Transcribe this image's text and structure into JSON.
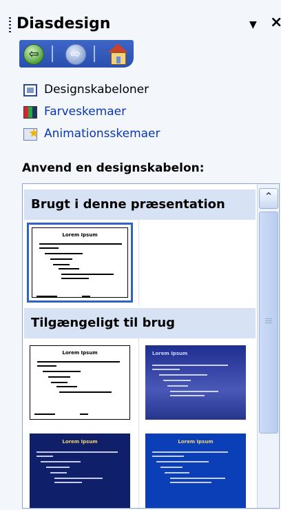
{
  "header": {
    "title": "Diasdesign",
    "dropdown_icon": "▼",
    "close_icon": "×"
  },
  "nav": {
    "back_icon": "⇦",
    "forward_icon": "⇨",
    "home_icon": "home"
  },
  "links": [
    {
      "label": "Designskabeloner",
      "icon": "design-template-icon",
      "color": "#000000"
    },
    {
      "label": "Farveskemaer",
      "icon": "color-scheme-icon",
      "color": "#0b35b8"
    },
    {
      "label": "Animationsskemaer",
      "icon": "animation-scheme-icon",
      "color": "#0b35b8"
    }
  ],
  "section_label": "Anvend en designskabelon:",
  "gallery": {
    "groups": [
      {
        "title": "Brugt i denne præsentation"
      },
      {
        "title": "Tilgængeligt til brug"
      }
    ],
    "thumb_title": "Lorem Ipsum"
  },
  "colors": {
    "accent": "#2a4fae",
    "link": "#0b35b8",
    "header_bg": "#d7e2f4"
  }
}
